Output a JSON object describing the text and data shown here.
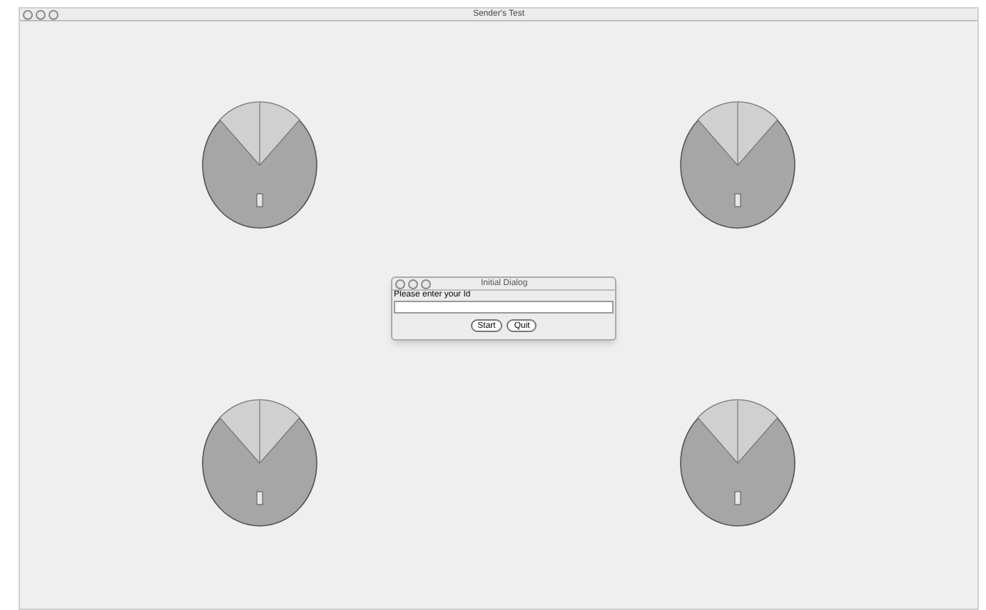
{
  "window": {
    "title": "Sender's Test"
  },
  "dialog": {
    "title": "Initial Dialog",
    "prompt": "Please enter your Id",
    "buttons": [
      "Start",
      "Quit"
    ]
  }
}
